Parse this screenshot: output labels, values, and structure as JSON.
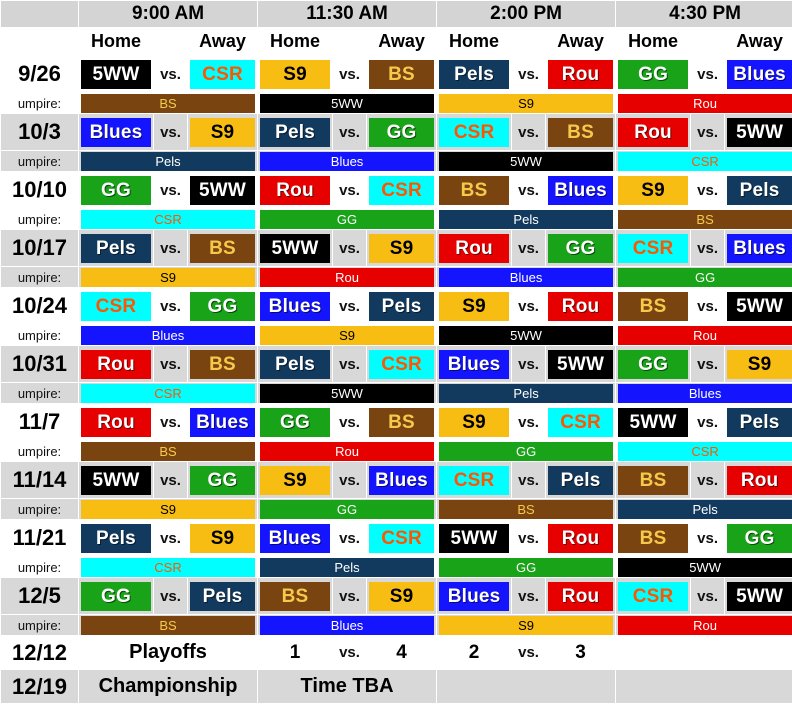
{
  "header": {
    "corner_label": "",
    "time_slots": [
      "9:00 AM",
      "11:30 AM",
      "2:00 PM",
      "4:30 PM"
    ],
    "home_label": "Home",
    "away_label": "Away",
    "vs_label": "vs.",
    "umpire_label": "umpire:"
  },
  "team_colors": {
    "5WW": {
      "bg": "#000000",
      "fg": "#ffffff"
    },
    "CSR": {
      "bg": "#00ffff",
      "fg": "#ff5500"
    },
    "S9": {
      "bg": "#f7bd12",
      "fg": "#000000"
    },
    "BS": {
      "bg": "#7a4410",
      "fg": "#f7c94b"
    },
    "Pels": {
      "bg": "#123a5e",
      "fg": "#ffffff"
    },
    "Rou": {
      "bg": "#e60000",
      "fg": "#ffffff"
    },
    "GG": {
      "bg": "#18a318",
      "fg": "#ffffff"
    },
    "Blues": {
      "bg": "#1414ff",
      "fg": "#ffffff"
    }
  },
  "rows": [
    {
      "date": "9/26",
      "games": [
        {
          "home": "5WW",
          "away": "CSR",
          "umpire": "BS"
        },
        {
          "home": "S9",
          "away": "BS",
          "umpire": "5WW"
        },
        {
          "home": "Pels",
          "away": "Rou",
          "umpire": "S9"
        },
        {
          "home": "GG",
          "away": "Blues",
          "umpire": "Rou"
        }
      ]
    },
    {
      "date": "10/3",
      "games": [
        {
          "home": "Blues",
          "away": "S9",
          "umpire": "Pels"
        },
        {
          "home": "Pels",
          "away": "GG",
          "umpire": "Blues"
        },
        {
          "home": "CSR",
          "away": "BS",
          "umpire": "5WW"
        },
        {
          "home": "Rou",
          "away": "5WW",
          "umpire": "CSR"
        }
      ]
    },
    {
      "date": "10/10",
      "games": [
        {
          "home": "GG",
          "away": "5WW",
          "umpire": "CSR"
        },
        {
          "home": "Rou",
          "away": "CSR",
          "umpire": "GG"
        },
        {
          "home": "BS",
          "away": "Blues",
          "umpire": "Pels"
        },
        {
          "home": "S9",
          "away": "Pels",
          "umpire": "BS"
        }
      ]
    },
    {
      "date": "10/17",
      "games": [
        {
          "home": "Pels",
          "away": "BS",
          "umpire": "S9"
        },
        {
          "home": "5WW",
          "away": "S9",
          "umpire": "Rou"
        },
        {
          "home": "Rou",
          "away": "GG",
          "umpire": "Blues"
        },
        {
          "home": "CSR",
          "away": "Blues",
          "umpire": "GG"
        }
      ]
    },
    {
      "date": "10/24",
      "games": [
        {
          "home": "CSR",
          "away": "GG",
          "umpire": "Blues"
        },
        {
          "home": "Blues",
          "away": "Pels",
          "umpire": "S9"
        },
        {
          "home": "S9",
          "away": "Rou",
          "umpire": "5WW"
        },
        {
          "home": "BS",
          "away": "5WW",
          "umpire": "Rou"
        }
      ]
    },
    {
      "date": "10/31",
      "games": [
        {
          "home": "Rou",
          "away": "BS",
          "umpire": "CSR"
        },
        {
          "home": "Pels",
          "away": "CSR",
          "umpire": "5WW"
        },
        {
          "home": "Blues",
          "away": "5WW",
          "umpire": "Pels"
        },
        {
          "home": "GG",
          "away": "S9",
          "umpire": "Blues"
        }
      ]
    },
    {
      "date": "11/7",
      "games": [
        {
          "home": "Rou",
          "away": "Blues",
          "umpire": "BS"
        },
        {
          "home": "GG",
          "away": "BS",
          "umpire": "Rou"
        },
        {
          "home": "S9",
          "away": "CSR",
          "umpire": "GG"
        },
        {
          "home": "5WW",
          "away": "Pels",
          "umpire": "CSR"
        }
      ]
    },
    {
      "date": "11/14",
      "games": [
        {
          "home": "5WW",
          "away": "GG",
          "umpire": "S9"
        },
        {
          "home": "S9",
          "away": "Blues",
          "umpire": "GG"
        },
        {
          "home": "CSR",
          "away": "Pels",
          "umpire": "BS"
        },
        {
          "home": "BS",
          "away": "Rou",
          "umpire": "Pels"
        }
      ]
    },
    {
      "date": "11/21",
      "games": [
        {
          "home": "Pels",
          "away": "S9",
          "umpire": "CSR"
        },
        {
          "home": "Blues",
          "away": "CSR",
          "umpire": "Pels"
        },
        {
          "home": "5WW",
          "away": "Rou",
          "umpire": "GG"
        },
        {
          "home": "BS",
          "away": "GG",
          "umpire": "5WW"
        }
      ]
    },
    {
      "date": "12/5",
      "games": [
        {
          "home": "GG",
          "away": "Pels",
          "umpire": "BS"
        },
        {
          "home": "BS",
          "away": "S9",
          "umpire": "Blues"
        },
        {
          "home": "Blues",
          "away": "Rou",
          "umpire": "S9"
        },
        {
          "home": "CSR",
          "away": "5WW",
          "umpire": "Rou"
        }
      ]
    }
  ],
  "playoffs": {
    "date": "12/12",
    "title": "Playoffs",
    "match_1": {
      "seed_home": "1",
      "vs": "vs.",
      "seed_away": "4"
    },
    "match_2": {
      "seed_home": "2",
      "vs": "vs.",
      "seed_away": "3"
    },
    "slot4": ""
  },
  "championship": {
    "date": "12/19",
    "title": "Championship",
    "time_note": "Time TBA",
    "slot3": "",
    "slot4": ""
  }
}
